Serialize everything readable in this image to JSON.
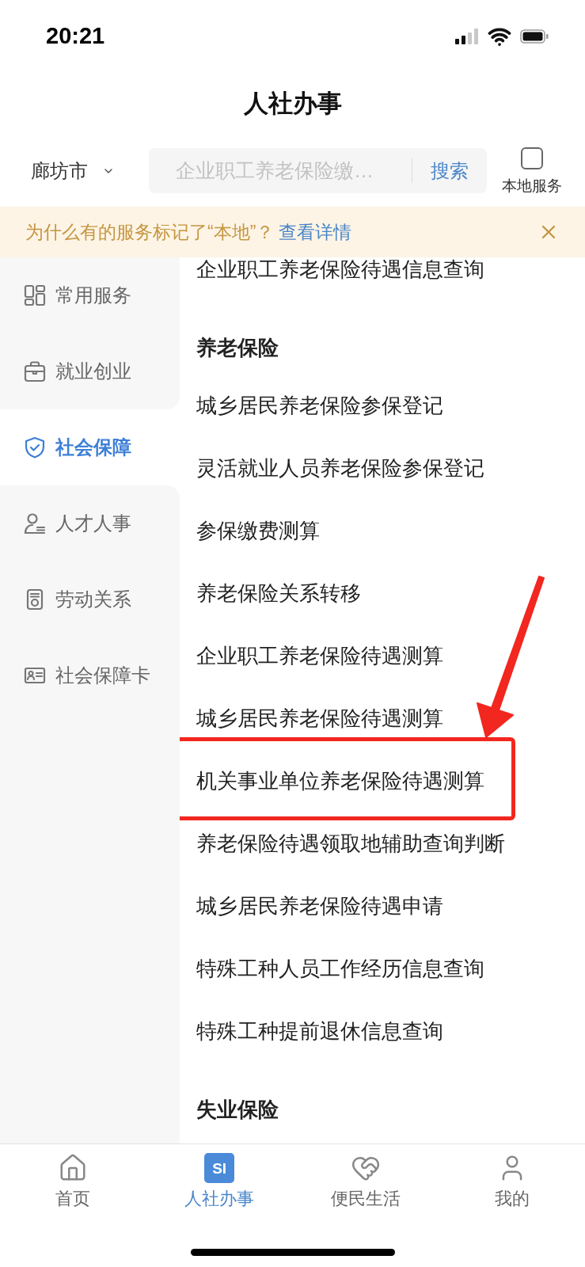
{
  "status_bar": {
    "time": "20:21"
  },
  "header": {
    "title": "人社办事"
  },
  "toolbar": {
    "city": "廊坊市",
    "search": {
      "placeholder": "企业职工养老保险缴…",
      "button": "搜索"
    },
    "local_service": {
      "label": "本地服务",
      "checked": false
    }
  },
  "notice": {
    "text": "为什么有的服务标记了“本地”？",
    "link": "查看详情"
  },
  "sidebar": {
    "items": [
      {
        "label": "常用服务",
        "selected": false
      },
      {
        "label": "就业创业",
        "selected": false
      },
      {
        "label": "社会保障",
        "selected": true
      },
      {
        "label": "人才人事",
        "selected": false
      },
      {
        "label": "劳动关系",
        "selected": false
      },
      {
        "label": "社会保障卡",
        "selected": false
      }
    ]
  },
  "services": [
    {
      "kind": "item",
      "label": "企业职工养老保险待遇信息查询",
      "highlighted": false
    },
    {
      "kind": "heading",
      "label": "养老保险"
    },
    {
      "kind": "item",
      "label": "城乡居民养老保险参保登记",
      "highlighted": false
    },
    {
      "kind": "item",
      "label": "灵活就业人员养老保险参保登记",
      "highlighted": false
    },
    {
      "kind": "item",
      "label": "参保缴费测算",
      "highlighted": false
    },
    {
      "kind": "item",
      "label": "养老保险关系转移",
      "highlighted": false
    },
    {
      "kind": "item",
      "label": "企业职工养老保险待遇测算",
      "highlighted": false
    },
    {
      "kind": "item",
      "label": "城乡居民养老保险待遇测算",
      "highlighted": false
    },
    {
      "kind": "item",
      "label": "机关事业单位养老保险待遇测算",
      "highlighted": true
    },
    {
      "kind": "item",
      "label": "养老保险待遇领取地辅助查询判断",
      "highlighted": false
    },
    {
      "kind": "item",
      "label": "城乡居民养老保险待遇申请",
      "highlighted": false
    },
    {
      "kind": "item",
      "label": "特殊工种人员工作经历信息查询",
      "highlighted": false
    },
    {
      "kind": "item",
      "label": "特殊工种提前退休信息查询",
      "highlighted": false
    },
    {
      "kind": "heading",
      "label": "失业保险"
    }
  ],
  "tab_bar": {
    "items": [
      {
        "label": "首页",
        "selected": false
      },
      {
        "label": "人社办事",
        "selected": true,
        "logo_text": "SI"
      },
      {
        "label": "便民生活",
        "selected": false
      },
      {
        "label": "我的",
        "selected": false
      }
    ]
  }
}
